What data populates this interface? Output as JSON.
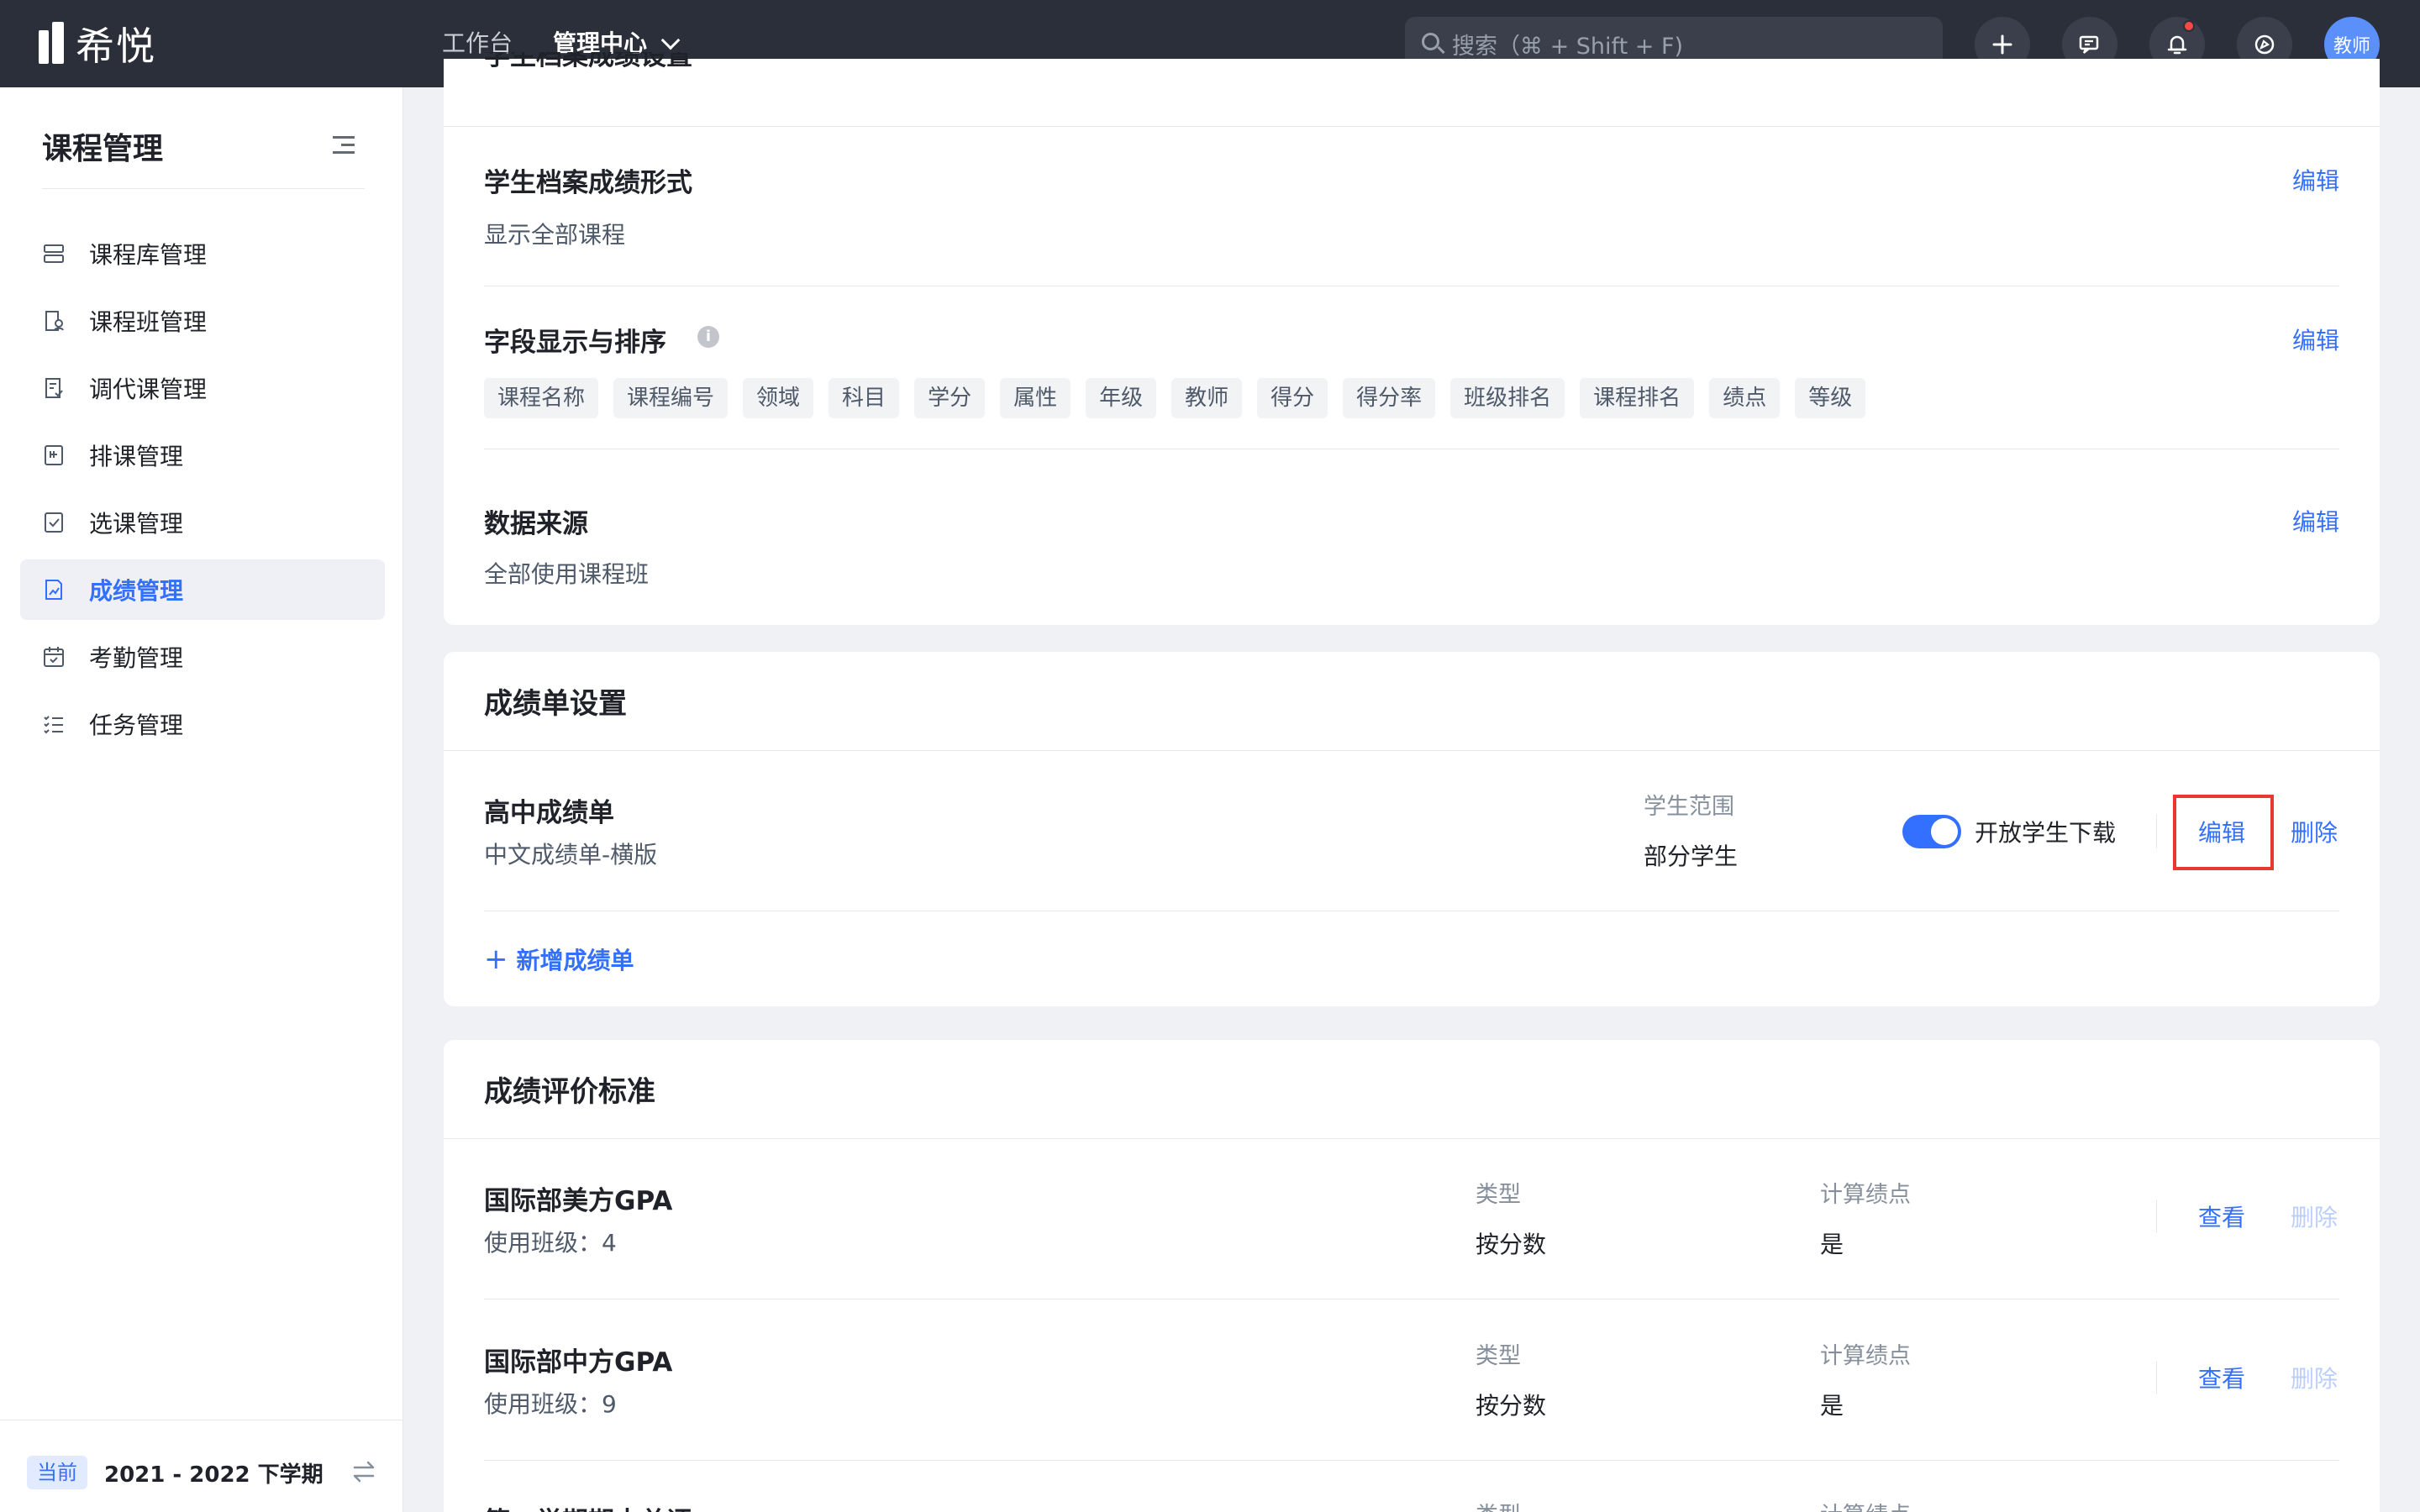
{
  "topbar": {
    "app_name": "希悦",
    "nav": [
      {
        "label": "工作台"
      },
      {
        "label": "管理中心"
      }
    ],
    "search_placeholder": "搜索（⌘ + Shift + F)",
    "avatar_label": "教师"
  },
  "sidebar": {
    "title": "课程管理",
    "items": [
      {
        "label": "课程库管理",
        "icon": "course-library-icon"
      },
      {
        "label": "课程班管理",
        "icon": "course-class-icon"
      },
      {
        "label": "调代课管理",
        "icon": "substitute-icon"
      },
      {
        "label": "排课管理",
        "icon": "schedule-icon"
      },
      {
        "label": "选课管理",
        "icon": "course-selection-icon"
      },
      {
        "label": "成绩管理",
        "icon": "grades-icon",
        "active": true
      },
      {
        "label": "考勤管理",
        "icon": "attendance-icon"
      },
      {
        "label": "任务管理",
        "icon": "task-icon"
      }
    ],
    "footer": {
      "current_tag": "当前",
      "term": "2021 - 2022 下学期"
    }
  },
  "archive_card": {
    "partial_heading": "学生档案成绩设置",
    "sections": [
      {
        "title": "学生档案成绩形式",
        "desc": "显示全部课程",
        "action": "编辑"
      },
      {
        "title": "字段显示与排序",
        "action": "编辑",
        "chips": [
          "课程名称",
          "课程编号",
          "领域",
          "科目",
          "学分",
          "属性",
          "年级",
          "教师",
          "得分",
          "得分率",
          "班级排名",
          "课程排名",
          "绩点",
          "等级"
        ]
      },
      {
        "title": "数据来源",
        "desc": "全部使用课程班",
        "action": "编辑"
      }
    ]
  },
  "report_card": {
    "heading": "成绩单设置",
    "row": {
      "title": "高中成绩单",
      "desc": "中文成绩单-横版",
      "scope_label": "学生范围",
      "scope_value": "部分学生",
      "toggle_label": "开放学生下载",
      "toggle_on": true,
      "edit": "编辑",
      "delete": "删除"
    },
    "add_label": "新增成绩单"
  },
  "criteria_card": {
    "heading": "成绩评价标准",
    "rows": [
      {
        "title": "国际部美方GPA",
        "used": "使用班级：4",
        "type_label": "类型",
        "type_value": "按分数",
        "gpa_label": "计算绩点",
        "gpa_value": "是",
        "view": "查看",
        "delete": "删除"
      },
      {
        "title": "国际部中方GPA",
        "used": "使用班级：9",
        "type_label": "类型",
        "type_value": "按分数",
        "gpa_label": "计算绩点",
        "gpa_value": "是",
        "view": "查看",
        "delete": "删除"
      }
    ],
    "partial_row": {
      "title": "第一学期期末总评",
      "type_label": "类型",
      "gpa_label": "计算绩点"
    }
  },
  "colors": {
    "accent": "#3370ff",
    "topbar": "#2b2f3a",
    "highlight": "#e8382f",
    "page_bg": "#f0f1f5"
  }
}
